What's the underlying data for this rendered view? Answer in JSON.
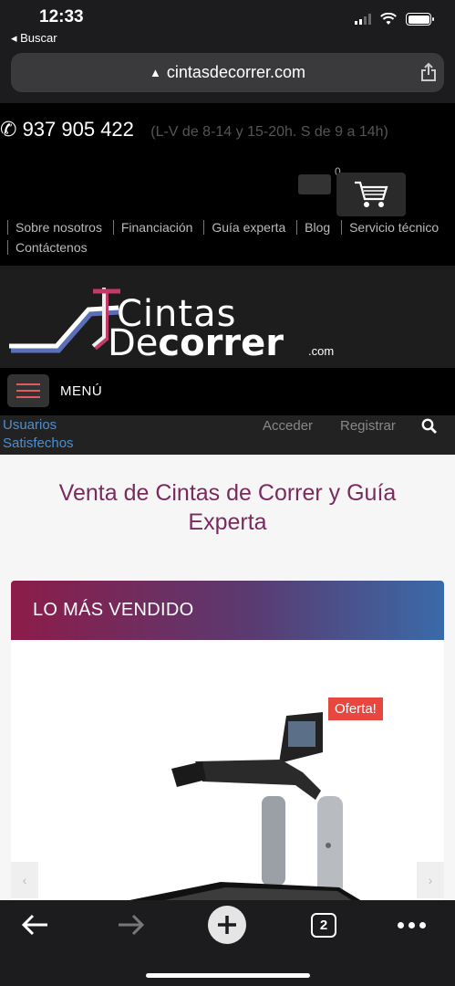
{
  "status_bar": {
    "time": "12:33",
    "back_app": "◂ Buscar"
  },
  "browser": {
    "url": "cintasdecorrer.com",
    "open_tabs": "2"
  },
  "header": {
    "phone_icon": "✆",
    "phone": "937 905 422",
    "hours": "(L-V de 8-14 y 15-20h. S de 9 a 14h)",
    "cart_count": "0",
    "nav": [
      "Sobre nosotros",
      "Financiación",
      "Guía experta",
      "Blog",
      "Servicio técnico",
      "Contáctenos"
    ]
  },
  "logo": {
    "line1": "Cintas",
    "line2_light": "De",
    "line2_bold": "correr",
    "suffix": ".com"
  },
  "menu": {
    "label": "MENÚ"
  },
  "user_bar": {
    "satisfied_line1": "Usuarios",
    "satisfied_line2": "Satisfechos",
    "login": "Acceder",
    "register": "Registrar"
  },
  "main": {
    "title": "Venta de Cintas de Correr y Guía Experta",
    "section_title": "LO MÁS VENDIDO",
    "badge": "Oferta!",
    "prev_arrow": "‹",
    "next_arrow": "›"
  },
  "colors": {
    "title": "#7a2a5e",
    "badge": "#e8473f",
    "link": "#4d8fd0",
    "menu_accent": "#e05a60"
  }
}
